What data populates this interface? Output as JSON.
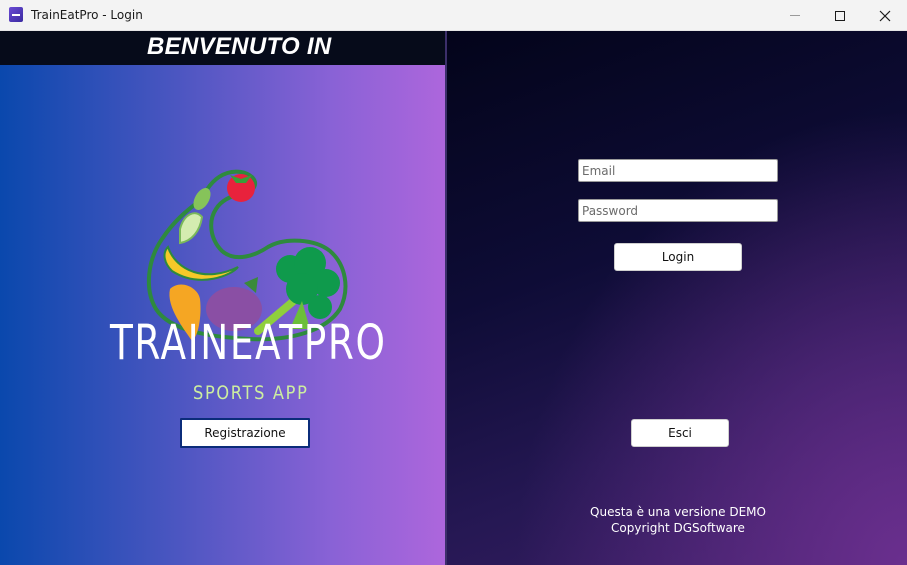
{
  "window": {
    "title": "TrainEatPro - Login"
  },
  "left": {
    "welcome": "BENVENUTO IN",
    "brand_name": "TRAINEATPRO",
    "brand_sub": "SPORTS APP",
    "register_label": "Registrazione"
  },
  "right": {
    "email_placeholder": "Email",
    "password_placeholder": "Password",
    "login_label": "Login",
    "exit_label": "Esci",
    "footer_line1": "Questa è una versione DEMO",
    "footer_line2": "Copyright DGSoftware"
  },
  "colors": {
    "left_gradient_start": "#0a48ad",
    "left_gradient_end": "#ad66dc",
    "brand_sub_color": "#cdeea0",
    "welcome_bar": "#060b1a"
  }
}
